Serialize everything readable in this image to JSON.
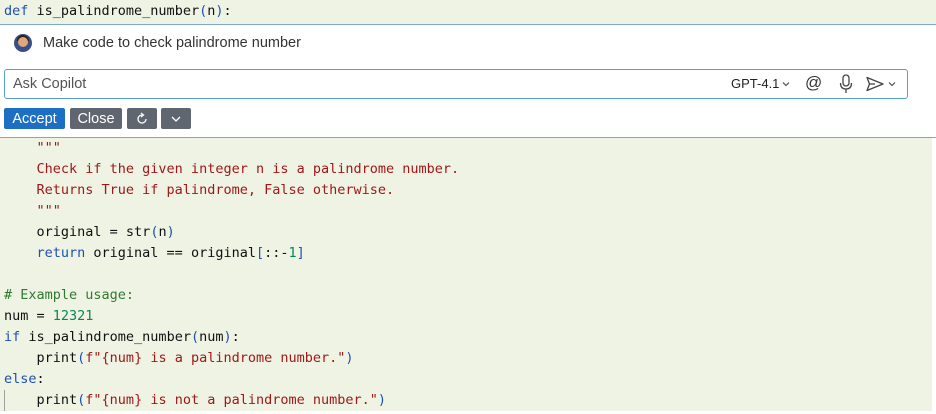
{
  "header_code": {
    "kw": "def",
    "name": " is_palindrome_number",
    "paren_open": "(",
    "arg": "n",
    "paren_close": ")",
    "colon": ":"
  },
  "copilot": {
    "prompt_text": "Make code to check palindrome number",
    "input_placeholder": "Ask Copilot",
    "model_label": "GPT-4.1",
    "mention_symbol": "@",
    "buttons": {
      "accept": "Accept",
      "close": "Close"
    }
  },
  "code_lines": {
    "l1": "    \"\"\"",
    "l2": "    Check if the given integer n is a palindrome number.",
    "l3": "    Returns True if palindrome, False otherwise.",
    "l4": "    \"\"\"",
    "l5a": "    original = str",
    "l5b": "(",
    "l5c": "n",
    "l5d": ")",
    "l6a": "    return",
    "l6b": " original == original",
    "l6c": "[",
    "l6d": "::-",
    "l6e": "1",
    "l6f": "]",
    "l8": "# Example usage:",
    "l9a": "num = ",
    "l9b": "12321",
    "l10a": "if",
    "l10b": " is_palindrome_number",
    "l10c": "(",
    "l10d": "num",
    "l10e": ")",
    "l10f": ":",
    "l11a": "    print",
    "l11b": "(",
    "l11c": "f\"{num} is a palindrome number.\"",
    "l11d": ")",
    "l12a": "else",
    "l12b": ":",
    "l13a": "    print",
    "l13b": "(",
    "l13c": "f\"{num} is not a palindrome number.\"",
    "l13d": ")"
  },
  "icons": [
    "avatar",
    "chevron-down-icon",
    "mic-icon",
    "send-icon",
    "refresh-icon"
  ],
  "colors": {
    "accent": "#1c6fc2",
    "diff_green": "#eef3e4",
    "border": "#5b9fd8"
  }
}
